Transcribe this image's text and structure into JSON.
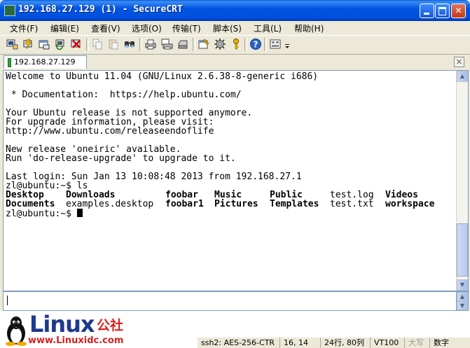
{
  "window": {
    "title": "192.168.27.129 (1) - SecureCRT"
  },
  "menu": [
    {
      "label": "文件(F)",
      "name": "menu-file"
    },
    {
      "label": "编辑(E)",
      "name": "menu-edit"
    },
    {
      "label": "查看(V)",
      "name": "menu-view"
    },
    {
      "label": "选项(O)",
      "name": "menu-options"
    },
    {
      "label": "传输(T)",
      "name": "menu-transfer"
    },
    {
      "label": "脚本(S)",
      "name": "menu-script"
    },
    {
      "label": "工具(L)",
      "name": "menu-tools"
    },
    {
      "label": "帮助(H)",
      "name": "menu-help"
    }
  ],
  "toolbar": {
    "icons": [
      "connect-icon",
      "quick-connect-icon",
      "connect-in-tab-icon",
      "reconnect-icon",
      "disconnect-icon",
      "copy-icon",
      "paste-icon",
      "find-icon",
      "print-icon",
      "print-selection-icon",
      "printer-icon",
      "session-options-icon",
      "global-options-icon",
      "key-map-icon",
      "help-icon",
      "keymap-editor-icon",
      "more-icon"
    ]
  },
  "tabs": [
    {
      "label": "192.168.27.129 (1)",
      "active": true
    }
  ],
  "terminal": {
    "lines": [
      "Welcome to Ubuntu 11.04 (GNU/Linux 2.6.38-8-generic i686)",
      "",
      " * Documentation:  https://help.ubuntu.com/",
      "",
      "Your Ubuntu release is not supported anymore.",
      "For upgrade information, please visit:",
      "http://www.ubuntu.com/releaseendoflife",
      "",
      "New release 'oneiric' available.",
      "Run 'do-release-upgrade' to upgrade to it.",
      "",
      "Last login: Sun Jan 13 10:08:48 2013 from 192.168.27.1",
      "zl@ubuntu:~$ ls"
    ],
    "ls_output": [
      [
        "Desktop",
        "Downloads",
        "foobar",
        "Music",
        "Public",
        "test.log",
        "Videos"
      ],
      [
        "Documents",
        "examples.desktop",
        "foobar1",
        "Pictures",
        "Templates",
        "test.txt",
        "workspace"
      ]
    ],
    "ls_bold": [
      [
        true,
        true,
        true,
        true,
        true,
        false,
        true
      ],
      [
        true,
        false,
        true,
        true,
        true,
        false,
        true
      ]
    ],
    "prompt": "zl@ubuntu:~$ "
  },
  "watermark": {
    "brand": "Linux",
    "brand_suffix": "公社",
    "site": "www.Linuxidc.com"
  },
  "statusbar": {
    "connection": "ssh2: AES-256-CTR",
    "cursor": "16,  14",
    "size": "24行, 80列",
    "terminal_type": "VT100",
    "caps": "大写",
    "num": "数字"
  },
  "colors": {
    "titlebar": "#0054e3",
    "terminal_bg": "#ffffff",
    "watermark_blue": "#1e3a8e",
    "watermark_red": "#d82020"
  }
}
